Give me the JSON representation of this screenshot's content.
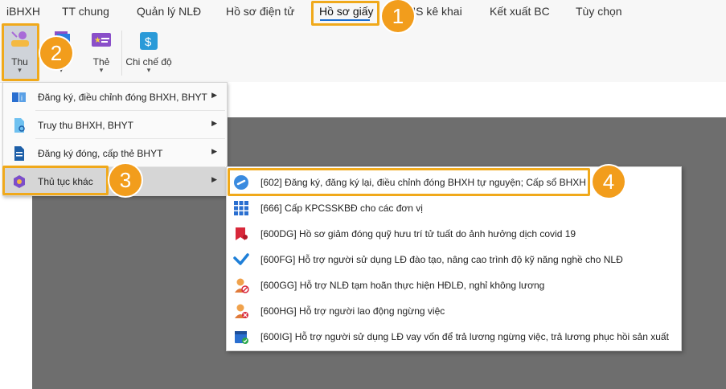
{
  "menubar": {
    "tabs": [
      {
        "label": "iBHXH"
      },
      {
        "label": "TT chung"
      },
      {
        "label": "Quản lý NLĐ"
      },
      {
        "label": "Hồ sơ điện tử"
      },
      {
        "label": "Hồ sơ giấy"
      },
      {
        "label": "HS kê khai"
      },
      {
        "label": "Kết xuất BC"
      },
      {
        "label": "Tùy chọn"
      }
    ]
  },
  "ribbon": {
    "buttons": [
      {
        "label": "Thu"
      },
      {
        "label": ""
      },
      {
        "label": "Thẻ"
      },
      {
        "label": "Chi chế độ"
      }
    ]
  },
  "badges": [
    "1",
    "2",
    "3",
    "4"
  ],
  "dropdown": {
    "items": [
      {
        "label": "Đăng ký, điều chỉnh đóng BHXH, BHYT"
      },
      {
        "label": "Truy thu BHXH, BHYT"
      },
      {
        "label": "Đăng ký đóng, cấp thẻ BHYT"
      },
      {
        "label": "Thủ tục khác"
      }
    ]
  },
  "submenu": {
    "items": [
      {
        "label": "[602] Đăng ký, đăng ký lại, điều chỉnh đóng BHXH tự nguyện; Cấp sổ BHXH"
      },
      {
        "label": "[666] Cấp KPCSSKBĐ cho các đơn vị"
      },
      {
        "label": "[600DG] Hồ sơ giảm đóng quỹ hưu trí tử tuất do ảnh hưởng dịch covid 19"
      },
      {
        "label": "[600FG] Hỗ trợ người sử dụng LĐ đào tạo, nâng cao trình độ kỹ năng nghề cho NLĐ"
      },
      {
        "label": "[600GG] Hỗ trợ NLĐ tạm hoãn thực hiện HĐLĐ, nghỉ không lương"
      },
      {
        "label": "[600HG] Hỗ trợ người lao động ngừng việc"
      },
      {
        "label": "[600IG] Hỗ trợ người sử dụng LĐ vay vốn để trả lương ngừng việc, trả lương phục hồi sản xuất"
      }
    ]
  },
  "colors": {
    "highlight": "#f0a91b",
    "badge": "#f29d1c",
    "accent": "#1e6fd0",
    "workspace": "#6e6e6e"
  }
}
